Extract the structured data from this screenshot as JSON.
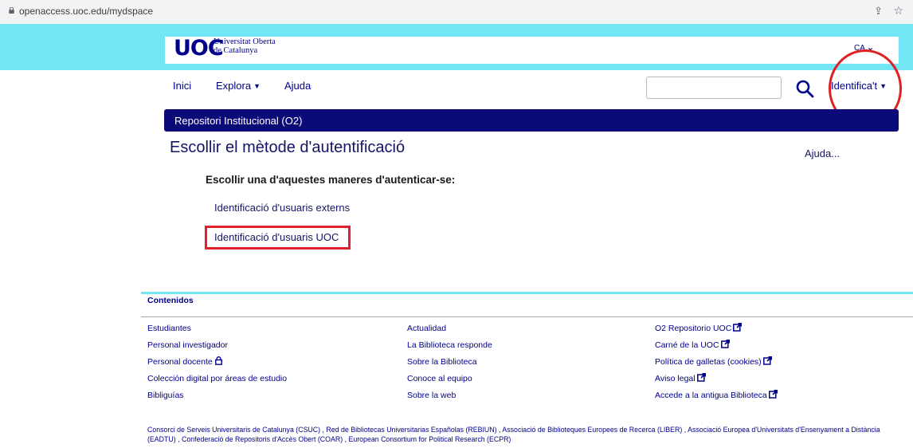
{
  "browser": {
    "url": "openaccess.uoc.edu/mydspace"
  },
  "header": {
    "logo_mark": "UOC",
    "logo_line1": "Universitat Oberta",
    "logo_line2": "de Catalunya",
    "language": "CA"
  },
  "nav": {
    "inici": "Inici",
    "explora": "Explora",
    "ajuda": "Ajuda",
    "search_placeholder": "",
    "identify": "Identifica't"
  },
  "breadcrumb": "Repositori Institucional (O2)",
  "main": {
    "title": "Escollir el mètode d'autentificació",
    "help_link": "Ajuda...",
    "instruction": "Escollir una d'aquestes maneres d'autenticar-se:",
    "options": [
      "Identificació d'usuaris externs",
      "Identificació d'usuaris UOC"
    ]
  },
  "footer": {
    "heading": "Contenidos",
    "col1": [
      "Estudiantes",
      "Personal investigador",
      "Personal docente",
      "Colección digital por áreas de estudio",
      "Bibliguías"
    ],
    "col2": [
      "Actualidad",
      "La Biblioteca responde",
      "Sobre la Biblioteca",
      "Conoce al equipo",
      "Sobre la web"
    ],
    "col3": [
      "O2 Repositorio UOC",
      "Carné de la UOC",
      "Política de galletas (cookies)",
      "Aviso legal",
      "Accede a la antigua Biblioteca"
    ],
    "consortia": "Consorci de Serveis Universitaris de Catalunya (CSUC) , Red de Bibliotecas Universitarias Españolas (REBIUN) , Associació de Biblioteques Europees de Recerca (LIBER) , Associació Europea d'Universitats d'Ensenyament a Distància (EADTU) , Confederació de Repositoris d'Accès Obert (COAR) , European Consortium for Political Research (ECPR)"
  },
  "colors": {
    "header_cyan": "#73e6f5",
    "navy": "#0a0a78",
    "highlight_red": "#e0202a"
  }
}
